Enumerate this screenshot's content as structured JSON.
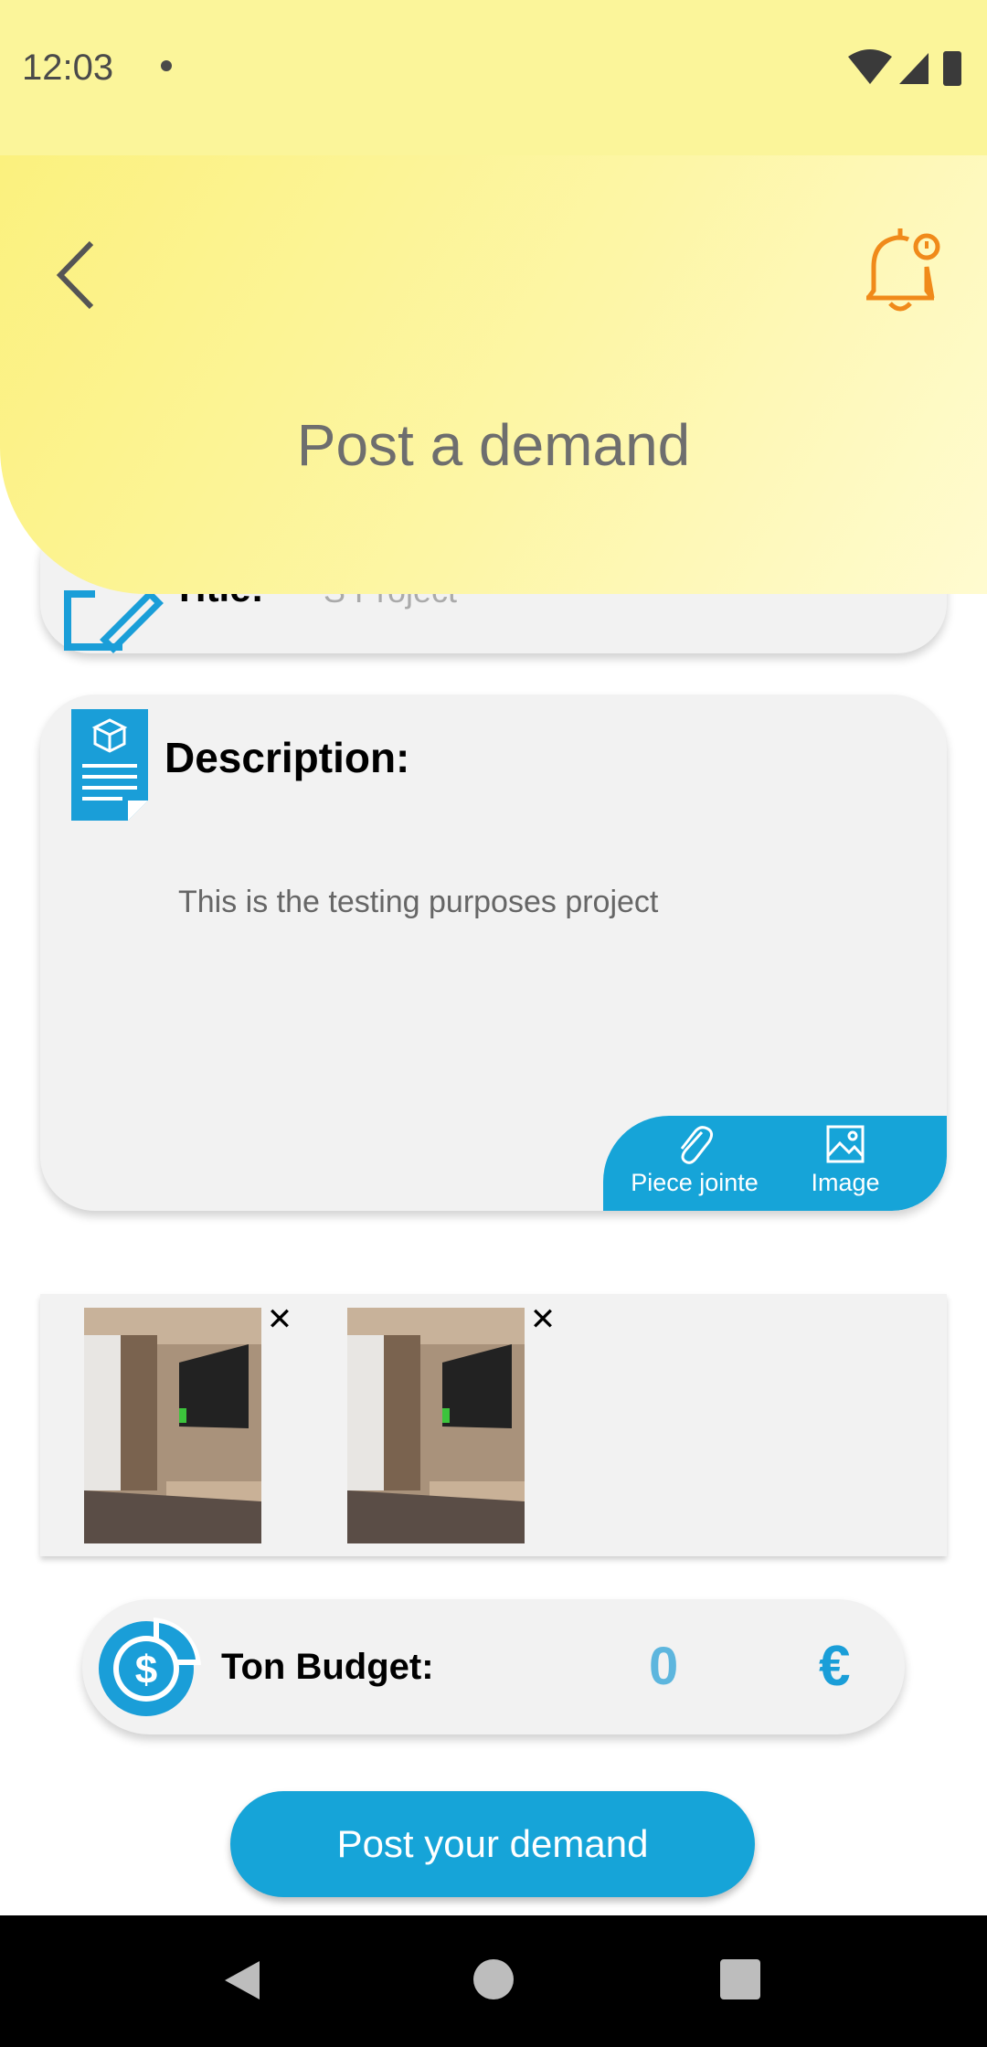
{
  "status_bar": {
    "time": "12:03"
  },
  "header": {
    "title": "Post a demand"
  },
  "title_field": {
    "label": "Title:",
    "value": "S Project"
  },
  "description": {
    "label": "Description:",
    "text": "This is the testing purposes project",
    "piece_label": "Piece jointe",
    "image_label": "Image"
  },
  "images": {
    "remove_symbol": "✕"
  },
  "budget": {
    "label": "Ton Budget:",
    "value": "0",
    "currency": "€"
  },
  "actions": {
    "post_label": "Post your demand"
  },
  "colors": {
    "accent": "#16a4d8",
    "header_yellow": "#fbf17e",
    "bell_orange": "#f08a1a"
  }
}
